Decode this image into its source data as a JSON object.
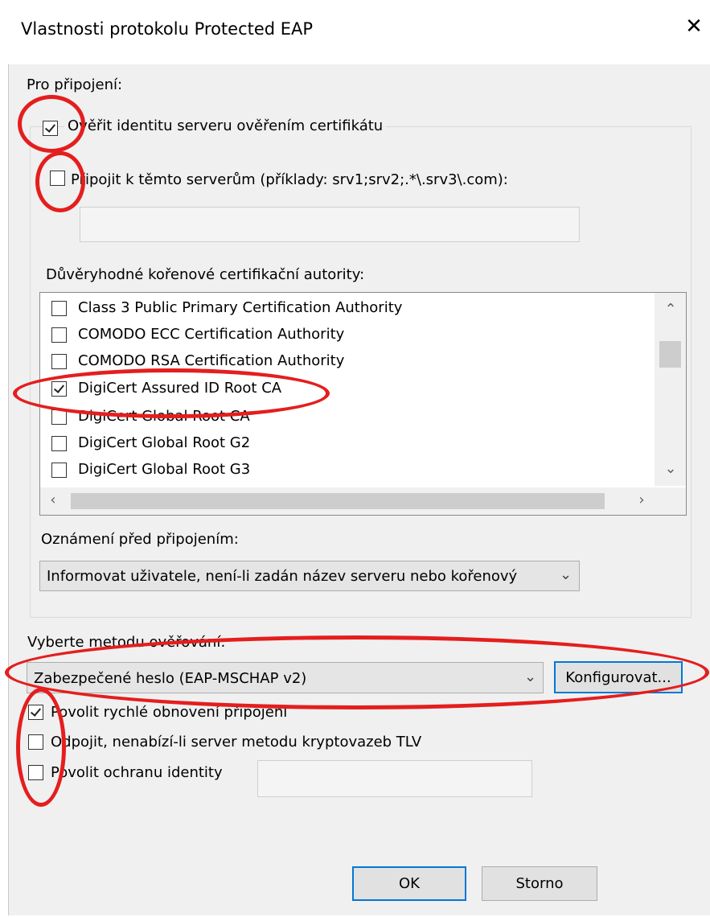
{
  "window": {
    "title": "Vlastnosti protokolu Protected EAP",
    "close_glyph": "✕"
  },
  "connect_section": {
    "label": "Pro připojení:",
    "verify_server_cert": {
      "label": "Ověřit identitu serveru ověřením certifikátu",
      "checked": true
    },
    "connect_to_servers": {
      "label": "Připojit k těmto serverům (příklady: srv1;srv2;.*\\.srv3\\.com):",
      "checked": false,
      "value": ""
    }
  },
  "trusted_cas": {
    "label": "Důvěryhodné kořenové certifikační autority:",
    "items": [
      {
        "label": "Class 3 Public Primary Certification Authority",
        "checked": false
      },
      {
        "label": "COMODO ECC Certification Authority",
        "checked": false
      },
      {
        "label": "COMODO RSA Certification Authority",
        "checked": false
      },
      {
        "label": "DigiCert Assured ID Root CA",
        "checked": true
      },
      {
        "label": "DigiCert Global Root CA",
        "checked": false
      },
      {
        "label": "DigiCert Global Root G2",
        "checked": false
      },
      {
        "label": "DigiCert Global Root G3",
        "checked": false
      }
    ]
  },
  "notification": {
    "label": "Oznámení před připojením:",
    "selected": "Informovat uživatele, není-li zadán název serveru nebo kořenový"
  },
  "auth_method": {
    "label": "Vyberte metodu ověřování:",
    "selected": "Zabezpečené heslo (EAP-MSCHAP v2)",
    "configure_button": "Konfigurovat..."
  },
  "options": {
    "fast_reconnect": {
      "label": "Povolit rychlé obnovení připojení",
      "checked": true
    },
    "disconnect_no_tlv": {
      "label": "Odpojit, nenabízí-li server metodu kryptovazeb TLV",
      "checked": false
    },
    "identity_privacy": {
      "label": "Povolit ochranu identity",
      "checked": false,
      "value": ""
    }
  },
  "buttons": {
    "ok": "OK",
    "cancel": "Storno"
  },
  "icons": {
    "scroll_up": "⌃",
    "scroll_down": "⌄",
    "scroll_left": "‹",
    "scroll_right": "›",
    "combo_chevron": "⌄"
  },
  "colors": {
    "annotation": "#e41e1e",
    "focus_border": "#0078d7"
  }
}
